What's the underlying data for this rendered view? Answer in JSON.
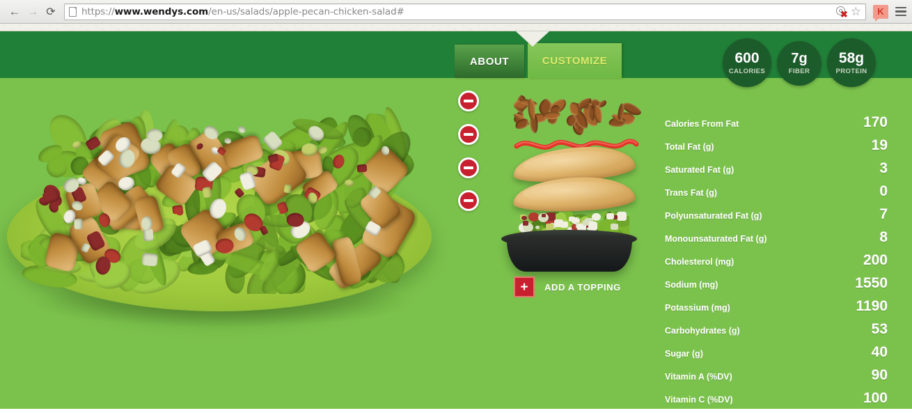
{
  "browser": {
    "back_icon": "back-arrow-icon",
    "forward_icon": "forward-arrow-icon",
    "reload_icon": "reload-icon",
    "page_icon": "document-icon",
    "url_scheme": "https://",
    "url_host": "www.wendys.com",
    "url_path": "/en-us/salads/apple-pecan-chicken-salad#",
    "blocked_icon": "blocked-content-icon",
    "bookmark_icon": "star-icon",
    "extension_badge": "K",
    "menu_icon": "hamburger-menu-icon"
  },
  "header": {
    "tabs": [
      {
        "label": "ABOUT",
        "active": false
      },
      {
        "label": "CUSTOMIZE",
        "active": true
      }
    ],
    "badges": [
      {
        "value": "600",
        "label": "CALORIES"
      },
      {
        "value": "7g",
        "label": "FIBER"
      },
      {
        "value": "58g",
        "label": "PROTEIN"
      }
    ]
  },
  "builder": {
    "remove_icon": "minus-circle-icon",
    "add_icon": "plus-icon",
    "add_topping_label": "ADD A TOPPING",
    "layers": [
      {
        "name": "pecans"
      },
      {
        "name": "dressing-drizzle"
      },
      {
        "name": "chicken-fillet-top"
      },
      {
        "name": "chicken-fillet-bottom"
      },
      {
        "name": "salad-bowl-base"
      }
    ]
  },
  "nutrition": [
    {
      "label": "Calories From Fat",
      "value": "170"
    },
    {
      "label": "Total Fat (g)",
      "value": "19"
    },
    {
      "label": "Saturated Fat (g)",
      "value": "3"
    },
    {
      "label": "Trans Fat (g)",
      "value": "0"
    },
    {
      "label": "Polyunsaturated Fat (g)",
      "value": "7"
    },
    {
      "label": "Monounsaturated Fat (g)",
      "value": "8"
    },
    {
      "label": "Cholesterol (mg)",
      "value": "200"
    },
    {
      "label": "Sodium (mg)",
      "value": "1550"
    },
    {
      "label": "Potassium (mg)",
      "value": "1190"
    },
    {
      "label": "Carbohydrates (g)",
      "value": "53"
    },
    {
      "label": "Sugar (g)",
      "value": "40"
    },
    {
      "label": "Vitamin A (%DV)",
      "value": "90"
    },
    {
      "label": "Vitamin C (%DV)",
      "value": "100"
    }
  ],
  "colors": {
    "header_green": "#218038",
    "body_green": "#7bc24c",
    "badge_green": "#1c5c2b",
    "accent_red": "#c8202e",
    "active_tab_text": "#dceb6c"
  }
}
